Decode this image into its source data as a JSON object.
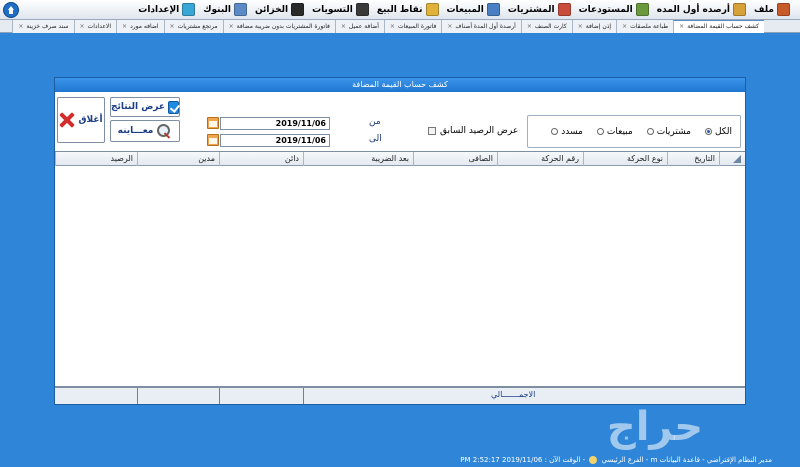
{
  "menu": [
    {
      "label": "ملف",
      "icon": "file-icon",
      "color": "#c85b2a"
    },
    {
      "label": "أرصده أول المده",
      "icon": "balances-icon",
      "color": "#d7a13a"
    },
    {
      "label": "المستودعات",
      "icon": "warehouse-icon",
      "color": "#6a9a3c"
    },
    {
      "label": "المشتريات",
      "icon": "purchases-icon",
      "color": "#c94d3b"
    },
    {
      "label": "المبيعات",
      "icon": "sales-icon",
      "color": "#4b7fc4"
    },
    {
      "label": "نقاط البيع",
      "icon": "pos-icon",
      "color": "#e0b23a"
    },
    {
      "label": "التسويات",
      "icon": "settlements-icon",
      "color": "#3a3a3a"
    },
    {
      "label": "الخزائن",
      "icon": "safes-icon",
      "color": "#2a2a2a"
    },
    {
      "label": "البنوك",
      "icon": "banks-icon",
      "color": "#5a8bc7"
    },
    {
      "label": "الإعدادات",
      "icon": "settings-icon",
      "color": "#39a7d6"
    }
  ],
  "tabs": [
    {
      "label": "كشف حساب القيمة المضافة",
      "active": true
    },
    {
      "label": "طباعة ملصقات",
      "active": false
    },
    {
      "label": "إذن إضافة",
      "active": false
    },
    {
      "label": "كارت الصنف",
      "active": false
    },
    {
      "label": "أرصدة أول المدة أصناف",
      "active": false
    },
    {
      "label": "فاتورة المبيعات",
      "active": false
    },
    {
      "label": "أضافة عميل",
      "active": false
    },
    {
      "label": "فاتورة المشتريات بدون ضريبة مضافة",
      "active": false
    },
    {
      "label": "مرتجع مشتريات",
      "active": false
    },
    {
      "label": "اضافه مورد",
      "active": false
    },
    {
      "label": "الاعدادات",
      "active": false
    },
    {
      "label": "سند صرف خزينة",
      "active": false
    }
  ],
  "window": {
    "title": "كشف حساب القيمة المضافة",
    "radios": [
      {
        "label": "الكل",
        "checked": true
      },
      {
        "label": "مشتريات",
        "checked": false
      },
      {
        "label": "مبيعات",
        "checked": false
      },
      {
        "label": "مسدد",
        "checked": false
      }
    ],
    "prev_balance_label": "عرض الرصيد السابق",
    "from_label": "من",
    "to_label": "الى",
    "from_date": "2019/11/06",
    "to_date": "2019/11/06",
    "show_results_label": "عرض النتائج",
    "preview_label": "معـــاينه",
    "close_label": "أغلاق",
    "columns": [
      "التاريخ",
      "نوع الحركة",
      "رقم الحركة",
      "الصافى",
      "بعد الضريبة",
      "دائن",
      "مدين",
      "الرصيد"
    ],
    "total_label": "الاجمـــــــالي"
  },
  "status": {
    "text": "مدير النظام الإفتراضي  -  قاعدة البيانات  m  -  الفرع الرئيسي",
    "time_label": "-  الوقت الآن :  2019/11/06 2:52:17 PM"
  },
  "watermark": "حراج",
  "colors": {
    "desktop": "#2f86d8",
    "title_bar": "#2a86df",
    "accent_text": "#1b3d86"
  }
}
